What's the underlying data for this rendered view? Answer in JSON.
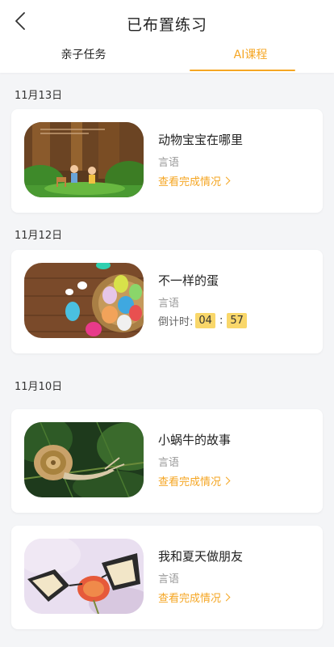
{
  "header": {
    "title": "已布置练习"
  },
  "tabs": [
    {
      "label": "亲子任务",
      "active": false
    },
    {
      "label": "AI课程",
      "active": true
    }
  ],
  "colors": {
    "accent": "#f5a623",
    "countdown_bg": "#f9d76a"
  },
  "groups": [
    {
      "date": "11月13日",
      "items": [
        {
          "title": "动物宝宝在哪里",
          "subject": "言语",
          "link": "查看完成情况"
        }
      ]
    },
    {
      "date": "11月12日",
      "items": [
        {
          "title": "不一样的蛋",
          "subject": "言语",
          "countdown_label": "倒计时:",
          "countdown_min": "04",
          "countdown_sep": ":",
          "countdown_sec": "57"
        }
      ]
    },
    {
      "date": "11月10日",
      "items": [
        {
          "title": "小蜗牛的故事",
          "subject": "言语",
          "link": "查看完成情况"
        },
        {
          "title": "我和夏天做朋友",
          "subject": "言语",
          "link": "查看完成情况"
        }
      ]
    }
  ]
}
